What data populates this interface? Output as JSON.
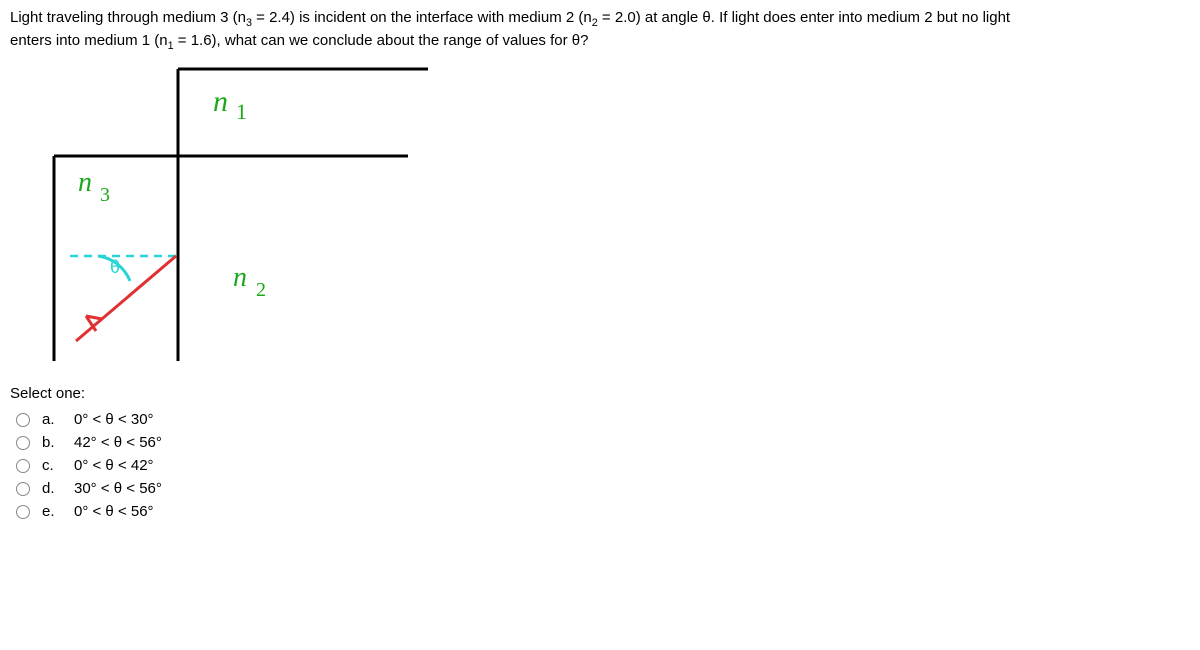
{
  "question": {
    "line1_parts": [
      "Light traveling through medium 3 (n",
      "3",
      " = 2.4) is incident on the interface with medium 2 (n",
      "2",
      " = 2.0) at angle θ. If light does enter into medium 2 but no light"
    ],
    "line2_parts": [
      "enters into medium 1 (n",
      "1",
      " = 1.6), what can we conclude about the range of values for θ?"
    ]
  },
  "diagram": {
    "label_n1": "n",
    "label_n1_sub": "1",
    "label_n2": "n",
    "label_n2_sub": "2",
    "label_n3": "n",
    "label_n3_sub": "3",
    "theta": "θ"
  },
  "select_label": "Select one:",
  "options": [
    {
      "letter": "a.",
      "text": "0° < θ < 30°"
    },
    {
      "letter": "b.",
      "text": "42° < θ < 56°"
    },
    {
      "letter": "c.",
      "text": "0° < θ < 42°"
    },
    {
      "letter": "d.",
      "text": "30° < θ < 56°"
    },
    {
      "letter": "e.",
      "text": "0° < θ < 56°"
    }
  ]
}
